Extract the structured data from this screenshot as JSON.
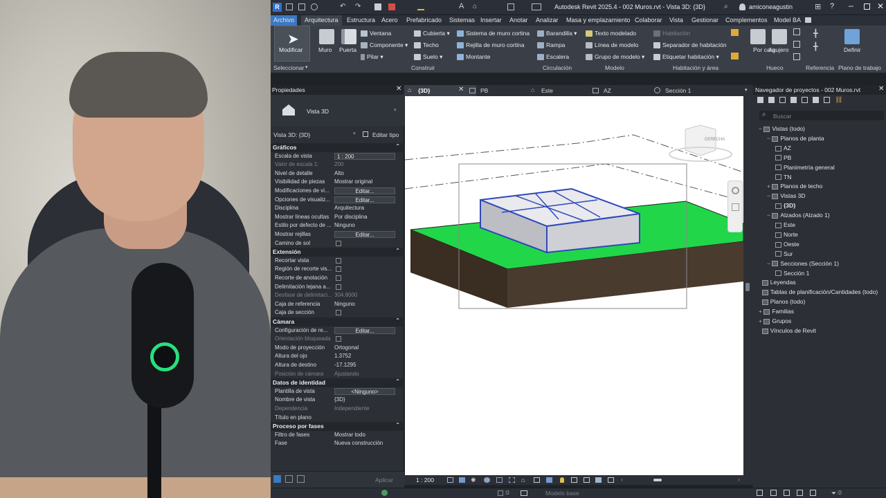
{
  "app": {
    "title": "Autodesk Revit 2025.4 - 002 Muros.rvt - Vista 3D: {3D}",
    "user": "amiconeagustin"
  },
  "menu": [
    "Archivo",
    "Arquitectura",
    "Estructura",
    "Acero",
    "Prefabricado",
    "Sistemas",
    "Insertar",
    "Anotar",
    "Analizar",
    "Masa y emplazamiento",
    "Colaborar",
    "Vista",
    "Gestionar",
    "Complementos",
    "Model BA"
  ],
  "ribbon": {
    "modify": "Modificar",
    "select_panel": "Seleccionar",
    "muro": "Muro",
    "puerta": "Puerta",
    "ventana": "Ventana",
    "componente": "Componente",
    "pilar": "Pilar",
    "cubierta": "Cubierta",
    "techo": "Techo",
    "suelo": "Suelo",
    "sistema_muro_cortina": "Sistema de muro cortina",
    "rejilla_muro_cortina": "Rejilla de muro cortina",
    "montante": "Montante",
    "construir_panel": "Construir",
    "barandilla": "Barandilla",
    "rampa": "Rampa",
    "escalera": "Escalera",
    "circulacion_panel": "Circulación",
    "texto_modelado": "Texto modelado",
    "linea_modelo": "Línea de modelo",
    "grupo_modelo": "Grupo de modelo",
    "modelo_panel": "Modelo",
    "habitacion": "Habitación",
    "separador_habitacion": "Separador de habitación",
    "etiquetar_habitacion": "Etiquetar habitación",
    "habitacion_area_panel": "Habitación y área",
    "por_cara": "Por cara",
    "agujero": "Agujero",
    "hueco_panel": "Hueco",
    "referencia_panel": "Referencia",
    "definir": "Definir",
    "plano_trabajo_panel": "Plano de trabajo"
  },
  "properties": {
    "title": "Propiedades",
    "type_name": "Vista 3D",
    "selector": "Vista 3D: {3D}",
    "edit_type": "Editar tipo",
    "apply": "Aplicar",
    "sections": [
      {
        "name": "Gráficos",
        "rows": [
          {
            "k": "Escala de vista",
            "v": "1 : 200",
            "kind": "input"
          },
          {
            "k": "Valor de escala    1:",
            "v": "200",
            "dim": true
          },
          {
            "k": "Nivel de detalle",
            "v": "Alto"
          },
          {
            "k": "Visibilidad de piezas",
            "v": "Mostrar original"
          },
          {
            "k": "Modificaciones de vi...",
            "v": "Editar...",
            "kind": "btn"
          },
          {
            "k": "Opciones de visualiz...",
            "v": "Editar...",
            "kind": "btn"
          },
          {
            "k": "Disciplina",
            "v": "Arquitectura"
          },
          {
            "k": "Mostrar líneas ocultas",
            "v": "Por disciplina"
          },
          {
            "k": "Estilo por defecto de ...",
            "v": "Ninguno"
          },
          {
            "k": "Mostrar rejillas",
            "v": "Editar...",
            "kind": "btn"
          },
          {
            "k": "Camino de sol",
            "v": "",
            "kind": "chk"
          }
        ]
      },
      {
        "name": "Extensión",
        "rows": [
          {
            "k": "Recortar vista",
            "v": "",
            "kind": "chk"
          },
          {
            "k": "Región de recorte vis...",
            "v": "",
            "kind": "chk"
          },
          {
            "k": "Recorte de anotación",
            "v": "",
            "kind": "chk"
          },
          {
            "k": "Delimitación lejana a...",
            "v": "",
            "kind": "chk"
          },
          {
            "k": "Desfase de delimitaci...",
            "v": "304.8000",
            "dim": true
          },
          {
            "k": "Caja de referencia",
            "v": "Ninguno"
          },
          {
            "k": "Caja de sección",
            "v": "",
            "kind": "chk"
          }
        ]
      },
      {
        "name": "Cámara",
        "rows": [
          {
            "k": "Configuración de re...",
            "v": "Editar...",
            "kind": "btn"
          },
          {
            "k": "Orientación bloqueada",
            "v": "",
            "dim": true,
            "kind": "chk"
          },
          {
            "k": "Modo de proyección",
            "v": "Ortogonal"
          },
          {
            "k": "Altura del ojo",
            "v": "1.3752"
          },
          {
            "k": "Altura de destino",
            "v": "-17.1295"
          },
          {
            "k": "Posición de cámara",
            "v": "Ajustando",
            "dim": true
          }
        ]
      },
      {
        "name": "Datos de identidad",
        "rows": [
          {
            "k": "Plantilla de vista",
            "v": "<Ninguno>",
            "kind": "btn"
          },
          {
            "k": "Nombre de vista",
            "v": "{3D}"
          },
          {
            "k": "Dependencia",
            "v": "Independiente",
            "dim": true
          },
          {
            "k": "Título en plano",
            "v": ""
          }
        ]
      },
      {
        "name": "Proceso por fases",
        "rows": [
          {
            "k": "Filtro de fases",
            "v": "Mostrar todo"
          },
          {
            "k": "Fase",
            "v": "Nueva construcción"
          }
        ]
      }
    ]
  },
  "view_tabs": [
    {
      "label": "{3D}",
      "active": true
    },
    {
      "label": "PB"
    },
    {
      "label": "Este"
    },
    {
      "label": "AZ"
    },
    {
      "label": "Sección 1"
    }
  ],
  "viewcube_label": "DERECHA",
  "view_status": {
    "scale": "1 : 200"
  },
  "browser": {
    "title": "Navegador de proyectos - 002 Muros.rvt",
    "search_placeholder": "Buscar",
    "tree": [
      {
        "label": "Vistas (todo)",
        "level": 0,
        "exp": "−"
      },
      {
        "label": "Planos de planta",
        "level": 1,
        "exp": "−"
      },
      {
        "label": "AZ",
        "level": 2,
        "box": true
      },
      {
        "label": "PB",
        "level": 2,
        "box": true
      },
      {
        "label": "Planimetría general",
        "level": 2,
        "box": true
      },
      {
        "label": "TN",
        "level": 2,
        "box": true
      },
      {
        "label": "Planos de techo",
        "level": 1,
        "exp": "+"
      },
      {
        "label": "Vistas 3D",
        "level": 1,
        "exp": "−"
      },
      {
        "label": "{3D}",
        "level": 2,
        "box": true,
        "bold": true
      },
      {
        "label": "Alzados (Alzado 1)",
        "level": 1,
        "exp": "−"
      },
      {
        "label": "Este",
        "level": 2,
        "box": true
      },
      {
        "label": "Norte",
        "level": 2,
        "box": true
      },
      {
        "label": "Oeste",
        "level": 2,
        "box": true
      },
      {
        "label": "Sur",
        "level": 2,
        "box": true
      },
      {
        "label": "Secciones (Sección 1)",
        "level": 1,
        "exp": "−"
      },
      {
        "label": "Sección 1",
        "level": 2,
        "box": true
      },
      {
        "label": "Leyendas",
        "level": 0
      },
      {
        "label": "Tablas de planificación/Cantidades (todo)",
        "level": 0
      },
      {
        "label": "Planos (todo)",
        "level": 0
      },
      {
        "label": "Familias",
        "level": 0,
        "exp": "+"
      },
      {
        "label": "Grupos",
        "level": 0,
        "exp": "+"
      },
      {
        "label": "Vínculos de Revit",
        "level": 0
      }
    ]
  },
  "statusbar": {
    "model": "Modelo base",
    "count_a": ":0",
    "count_b": ":0"
  },
  "colors": {
    "accent": "#3c78c2",
    "grass": "#22d64a",
    "earth": "#4a3b2f",
    "wall_outline": "#2e49b8"
  }
}
